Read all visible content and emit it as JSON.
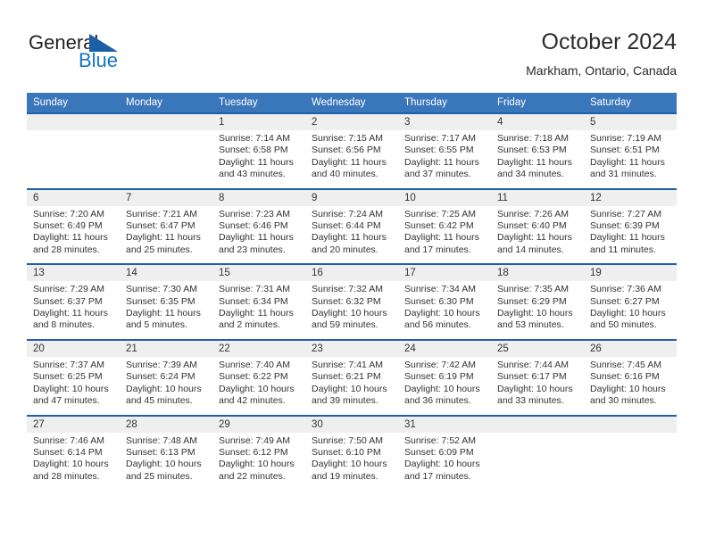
{
  "brand": {
    "name_part1": "General",
    "name_part2": "Blue",
    "triangle_icon": "triangle-icon"
  },
  "header": {
    "title": "October 2024",
    "location": "Markham, Ontario, Canada"
  },
  "colors": {
    "header_blue": "#3a76ba",
    "separator_blue": "#1f5fa9",
    "daynum_band": "#efefef",
    "logo_blue": "#1277c4",
    "logo_dark": "#231f20",
    "text": "#333333"
  },
  "calendar": {
    "weekday_headers": [
      "Sunday",
      "Monday",
      "Tuesday",
      "Wednesday",
      "Thursday",
      "Friday",
      "Saturday"
    ],
    "weeks": [
      [
        {
          "day": "",
          "sunrise": "",
          "sunset": "",
          "daylight_line1": "",
          "daylight_line2": ""
        },
        {
          "day": "",
          "sunrise": "",
          "sunset": "",
          "daylight_line1": "",
          "daylight_line2": ""
        },
        {
          "day": "1",
          "sunrise": "Sunrise: 7:14 AM",
          "sunset": "Sunset: 6:58 PM",
          "daylight_line1": "Daylight: 11 hours",
          "daylight_line2": "and 43 minutes."
        },
        {
          "day": "2",
          "sunrise": "Sunrise: 7:15 AM",
          "sunset": "Sunset: 6:56 PM",
          "daylight_line1": "Daylight: 11 hours",
          "daylight_line2": "and 40 minutes."
        },
        {
          "day": "3",
          "sunrise": "Sunrise: 7:17 AM",
          "sunset": "Sunset: 6:55 PM",
          "daylight_line1": "Daylight: 11 hours",
          "daylight_line2": "and 37 minutes."
        },
        {
          "day": "4",
          "sunrise": "Sunrise: 7:18 AM",
          "sunset": "Sunset: 6:53 PM",
          "daylight_line1": "Daylight: 11 hours",
          "daylight_line2": "and 34 minutes."
        },
        {
          "day": "5",
          "sunrise": "Sunrise: 7:19 AM",
          "sunset": "Sunset: 6:51 PM",
          "daylight_line1": "Daylight: 11 hours",
          "daylight_line2": "and 31 minutes."
        }
      ],
      [
        {
          "day": "6",
          "sunrise": "Sunrise: 7:20 AM",
          "sunset": "Sunset: 6:49 PM",
          "daylight_line1": "Daylight: 11 hours",
          "daylight_line2": "and 28 minutes."
        },
        {
          "day": "7",
          "sunrise": "Sunrise: 7:21 AM",
          "sunset": "Sunset: 6:47 PM",
          "daylight_line1": "Daylight: 11 hours",
          "daylight_line2": "and 25 minutes."
        },
        {
          "day": "8",
          "sunrise": "Sunrise: 7:23 AM",
          "sunset": "Sunset: 6:46 PM",
          "daylight_line1": "Daylight: 11 hours",
          "daylight_line2": "and 23 minutes."
        },
        {
          "day": "9",
          "sunrise": "Sunrise: 7:24 AM",
          "sunset": "Sunset: 6:44 PM",
          "daylight_line1": "Daylight: 11 hours",
          "daylight_line2": "and 20 minutes."
        },
        {
          "day": "10",
          "sunrise": "Sunrise: 7:25 AM",
          "sunset": "Sunset: 6:42 PM",
          "daylight_line1": "Daylight: 11 hours",
          "daylight_line2": "and 17 minutes."
        },
        {
          "day": "11",
          "sunrise": "Sunrise: 7:26 AM",
          "sunset": "Sunset: 6:40 PM",
          "daylight_line1": "Daylight: 11 hours",
          "daylight_line2": "and 14 minutes."
        },
        {
          "day": "12",
          "sunrise": "Sunrise: 7:27 AM",
          "sunset": "Sunset: 6:39 PM",
          "daylight_line1": "Daylight: 11 hours",
          "daylight_line2": "and 11 minutes."
        }
      ],
      [
        {
          "day": "13",
          "sunrise": "Sunrise: 7:29 AM",
          "sunset": "Sunset: 6:37 PM",
          "daylight_line1": "Daylight: 11 hours",
          "daylight_line2": "and 8 minutes."
        },
        {
          "day": "14",
          "sunrise": "Sunrise: 7:30 AM",
          "sunset": "Sunset: 6:35 PM",
          "daylight_line1": "Daylight: 11 hours",
          "daylight_line2": "and 5 minutes."
        },
        {
          "day": "15",
          "sunrise": "Sunrise: 7:31 AM",
          "sunset": "Sunset: 6:34 PM",
          "daylight_line1": "Daylight: 11 hours",
          "daylight_line2": "and 2 minutes."
        },
        {
          "day": "16",
          "sunrise": "Sunrise: 7:32 AM",
          "sunset": "Sunset: 6:32 PM",
          "daylight_line1": "Daylight: 10 hours",
          "daylight_line2": "and 59 minutes."
        },
        {
          "day": "17",
          "sunrise": "Sunrise: 7:34 AM",
          "sunset": "Sunset: 6:30 PM",
          "daylight_line1": "Daylight: 10 hours",
          "daylight_line2": "and 56 minutes."
        },
        {
          "day": "18",
          "sunrise": "Sunrise: 7:35 AM",
          "sunset": "Sunset: 6:29 PM",
          "daylight_line1": "Daylight: 10 hours",
          "daylight_line2": "and 53 minutes."
        },
        {
          "day": "19",
          "sunrise": "Sunrise: 7:36 AM",
          "sunset": "Sunset: 6:27 PM",
          "daylight_line1": "Daylight: 10 hours",
          "daylight_line2": "and 50 minutes."
        }
      ],
      [
        {
          "day": "20",
          "sunrise": "Sunrise: 7:37 AM",
          "sunset": "Sunset: 6:25 PM",
          "daylight_line1": "Daylight: 10 hours",
          "daylight_line2": "and 47 minutes."
        },
        {
          "day": "21",
          "sunrise": "Sunrise: 7:39 AM",
          "sunset": "Sunset: 6:24 PM",
          "daylight_line1": "Daylight: 10 hours",
          "daylight_line2": "and 45 minutes."
        },
        {
          "day": "22",
          "sunrise": "Sunrise: 7:40 AM",
          "sunset": "Sunset: 6:22 PM",
          "daylight_line1": "Daylight: 10 hours",
          "daylight_line2": "and 42 minutes."
        },
        {
          "day": "23",
          "sunrise": "Sunrise: 7:41 AM",
          "sunset": "Sunset: 6:21 PM",
          "daylight_line1": "Daylight: 10 hours",
          "daylight_line2": "and 39 minutes."
        },
        {
          "day": "24",
          "sunrise": "Sunrise: 7:42 AM",
          "sunset": "Sunset: 6:19 PM",
          "daylight_line1": "Daylight: 10 hours",
          "daylight_line2": "and 36 minutes."
        },
        {
          "day": "25",
          "sunrise": "Sunrise: 7:44 AM",
          "sunset": "Sunset: 6:17 PM",
          "daylight_line1": "Daylight: 10 hours",
          "daylight_line2": "and 33 minutes."
        },
        {
          "day": "26",
          "sunrise": "Sunrise: 7:45 AM",
          "sunset": "Sunset: 6:16 PM",
          "daylight_line1": "Daylight: 10 hours",
          "daylight_line2": "and 30 minutes."
        }
      ],
      [
        {
          "day": "27",
          "sunrise": "Sunrise: 7:46 AM",
          "sunset": "Sunset: 6:14 PM",
          "daylight_line1": "Daylight: 10 hours",
          "daylight_line2": "and 28 minutes."
        },
        {
          "day": "28",
          "sunrise": "Sunrise: 7:48 AM",
          "sunset": "Sunset: 6:13 PM",
          "daylight_line1": "Daylight: 10 hours",
          "daylight_line2": "and 25 minutes."
        },
        {
          "day": "29",
          "sunrise": "Sunrise: 7:49 AM",
          "sunset": "Sunset: 6:12 PM",
          "daylight_line1": "Daylight: 10 hours",
          "daylight_line2": "and 22 minutes."
        },
        {
          "day": "30",
          "sunrise": "Sunrise: 7:50 AM",
          "sunset": "Sunset: 6:10 PM",
          "daylight_line1": "Daylight: 10 hours",
          "daylight_line2": "and 19 minutes."
        },
        {
          "day": "31",
          "sunrise": "Sunrise: 7:52 AM",
          "sunset": "Sunset: 6:09 PM",
          "daylight_line1": "Daylight: 10 hours",
          "daylight_line2": "and 17 minutes."
        },
        {
          "day": "",
          "sunrise": "",
          "sunset": "",
          "daylight_line1": "",
          "daylight_line2": ""
        },
        {
          "day": "",
          "sunrise": "",
          "sunset": "",
          "daylight_line1": "",
          "daylight_line2": ""
        }
      ]
    ]
  }
}
